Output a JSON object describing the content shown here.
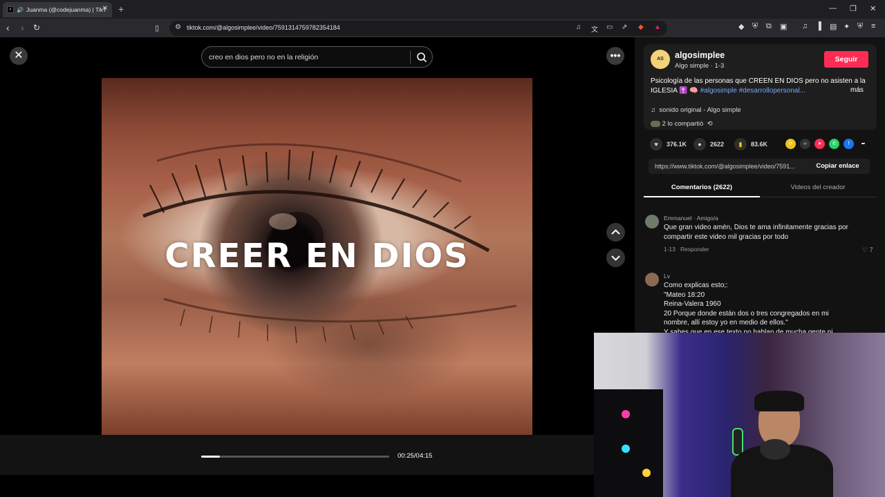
{
  "browser": {
    "tab_title": "Juanma (@codejuanma) | TikT",
    "url": "tiktok.com/@algosimplee/video/7591314759782354184"
  },
  "search": {
    "query": "creo en dios pero no en la religión"
  },
  "video": {
    "caption": "CREER EN DIOS",
    "time": "00:25/04:15",
    "progress": 0.098
  },
  "creator": {
    "username": "algosimplee",
    "avatar_text": "AS",
    "info": "Algo simple · 1-3",
    "follow_label": "Seguir"
  },
  "description": {
    "text": "Psicología de las personas que CREEN EN DIOS pero no asisten a la IGLESIA ✝️ 🧠 ",
    "tags": "#algosimple #desarrollopersonal...",
    "more_label": "más"
  },
  "sound": {
    "label": "sonido original - Algo simple"
  },
  "shared": {
    "label": "2 lo compartió"
  },
  "stats": {
    "likes": "376.1K",
    "comments": "2622",
    "saves": "83.6K"
  },
  "link": {
    "url": "https://www.tiktok.com/@algosimplee/video/7591...",
    "copy_label": "Copiar enlace"
  },
  "tabs": {
    "comments": "Comentarios (2622)",
    "creator_videos": "Videos del creador"
  },
  "comments": [
    {
      "author": "Emmanuel · Amigo/a",
      "text": "Que gran video amén, Dios te ama infinitamente gracias por compartir este video mil gracias por todo",
      "date": "1-13",
      "reply_label": "Responder",
      "likes": "7"
    },
    {
      "author": "Lv",
      "lines": [
        "Como explicas esto;:",
        "\"Mateo 18:20",
        "Reina-Valera 1960",
        "20 Porque donde están dos o tres congregados en mi nombre, allí estoy yo en medio de ellos.\"",
        "Y sabes que en ese texto no hablan de mucha gente ni"
      ]
    }
  ],
  "colors": {
    "follow": "#fe2c55",
    "tags": "#7aa8ff",
    "panel_bg": "#121212"
  }
}
